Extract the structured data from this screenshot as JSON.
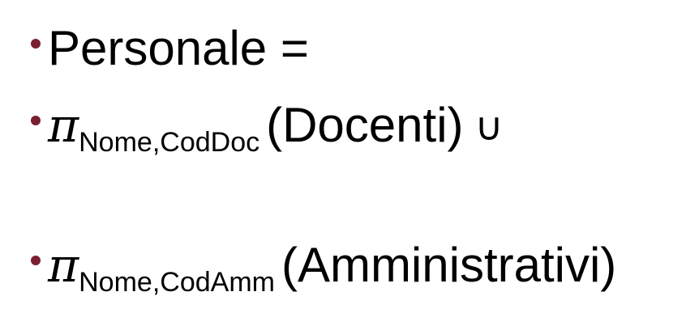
{
  "bullets": [
    {
      "text": "Personale ="
    },
    {
      "operator": "π",
      "subscript": "Nome,CodDoc",
      "argument": "(Docenti)",
      "trailing": "∪"
    },
    {
      "operator": "π",
      "subscript": "Nome,CodAmm",
      "argument": "(Amministrativi)"
    }
  ],
  "colors": {
    "bullet": "#7a1f32",
    "text": "#000000",
    "background": "#ffffff"
  }
}
